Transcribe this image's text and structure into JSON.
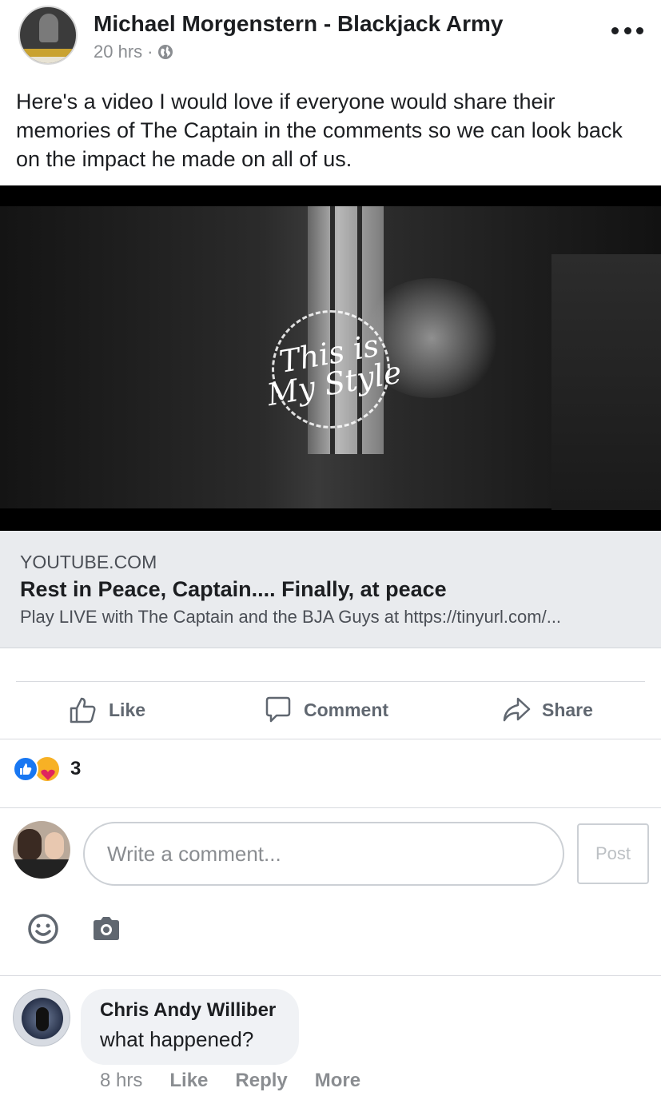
{
  "post": {
    "author": "Michael Morgenstern - Blackjack Army",
    "time": "20 hrs",
    "meta_separator": "·",
    "text": "Here's a video I would love if everyone would share their memories of The Captain in the comments so we can look back on the impact he made on all of us."
  },
  "video": {
    "logo_text": "This is My Style"
  },
  "link_preview": {
    "domain": "YOUTUBE.COM",
    "title": "Rest in Peace, Captain.... Finally, at peace",
    "description": "Play LIVE with The Captain and the BJA Guys at https://tinyurl.com/..."
  },
  "actions": {
    "like": "Like",
    "comment": "Comment",
    "share": "Share"
  },
  "reactions": {
    "types": [
      "like",
      "care"
    ],
    "count": "3"
  },
  "composer": {
    "placeholder": "Write a comment...",
    "post_label": "Post"
  },
  "comments": [
    {
      "author": "Chris Andy Williber",
      "text": "what happened?",
      "time": "8 hrs",
      "like": "Like",
      "reply": "Reply",
      "more": "More"
    }
  ],
  "colors": {
    "text": "#1c1e21",
    "secondary": "#8a8d91",
    "action": "#606770",
    "link_bg": "#e9ebee",
    "like_blue": "#1877f2",
    "care_yellow": "#f7b125",
    "care_heart": "#e0245e",
    "bubble_bg": "#f0f2f5"
  },
  "icons": [
    "more-icon",
    "globe-icon",
    "like-icon",
    "comment-icon",
    "share-icon",
    "like-reaction-icon",
    "care-reaction-icon",
    "emoji-icon",
    "camera-icon"
  ]
}
